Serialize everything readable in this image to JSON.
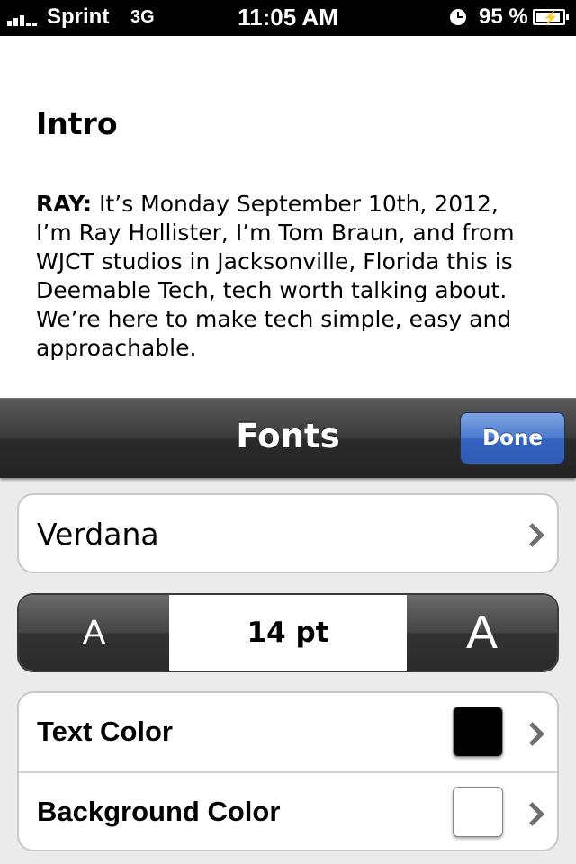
{
  "status_bar": {
    "carrier": "Sprint",
    "network": "3G",
    "time": "11:05 AM",
    "battery_percent": "95 %"
  },
  "article": {
    "title": "Intro",
    "speaker": "RAY:",
    "body": " It’s Monday September 10th, 2012, I’m Ray Hollister, I’m Tom Braun, and from WJCT studios in Jacksonville, Florida this is Deemable Tech, tech worth talking about. We’re here to make tech simple, easy and approachable."
  },
  "fonts_panel": {
    "title": "Fonts",
    "done_label": "Done",
    "font_name": "Verdana",
    "decrease_label": "A",
    "increase_label": "A",
    "size_value": "14 pt",
    "text_color_label": "Text Color",
    "text_color": "#000000",
    "background_color_label": "Background Color",
    "background_color": "#ffffff"
  },
  "colors": {
    "done_button": "#3a6bc6",
    "nav_bar": "#2f2f2f",
    "sheet_background": "#ebebeb"
  }
}
